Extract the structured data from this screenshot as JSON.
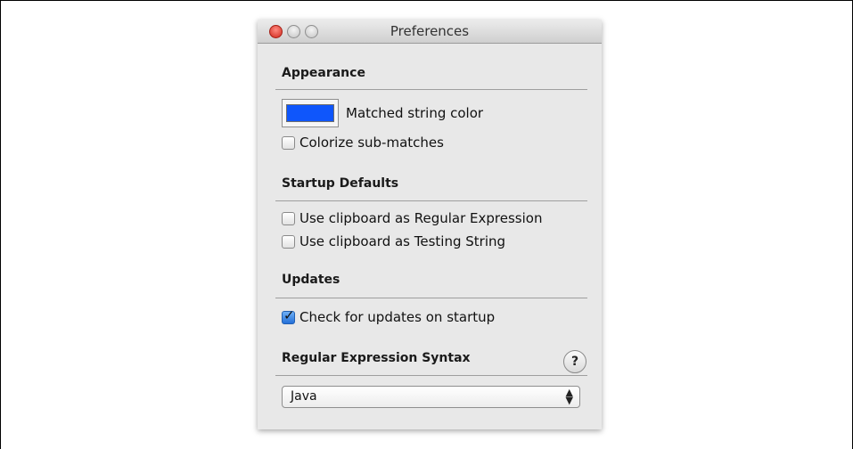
{
  "window": {
    "title": "Preferences"
  },
  "sections": {
    "appearance": {
      "heading": "Appearance",
      "matched_color_label": "Matched string color",
      "matched_color": "#0f56fb",
      "colorize_label": "Colorize sub-matches",
      "colorize_checked": false
    },
    "startup": {
      "heading": "Startup Defaults",
      "regex_label": "Use clipboard as Regular Expression",
      "regex_checked": false,
      "testing_label": "Use clipboard as Testing String",
      "testing_checked": false
    },
    "updates": {
      "heading": "Updates",
      "check_label": "Check for updates on startup",
      "check_checked": true
    },
    "syntax": {
      "heading": "Regular Expression Syntax",
      "help_label": "?",
      "selected": "Java",
      "arrows": "▲▼"
    }
  },
  "icons": {
    "help": "help-icon",
    "select_arrows": "updown-arrows-icon"
  }
}
